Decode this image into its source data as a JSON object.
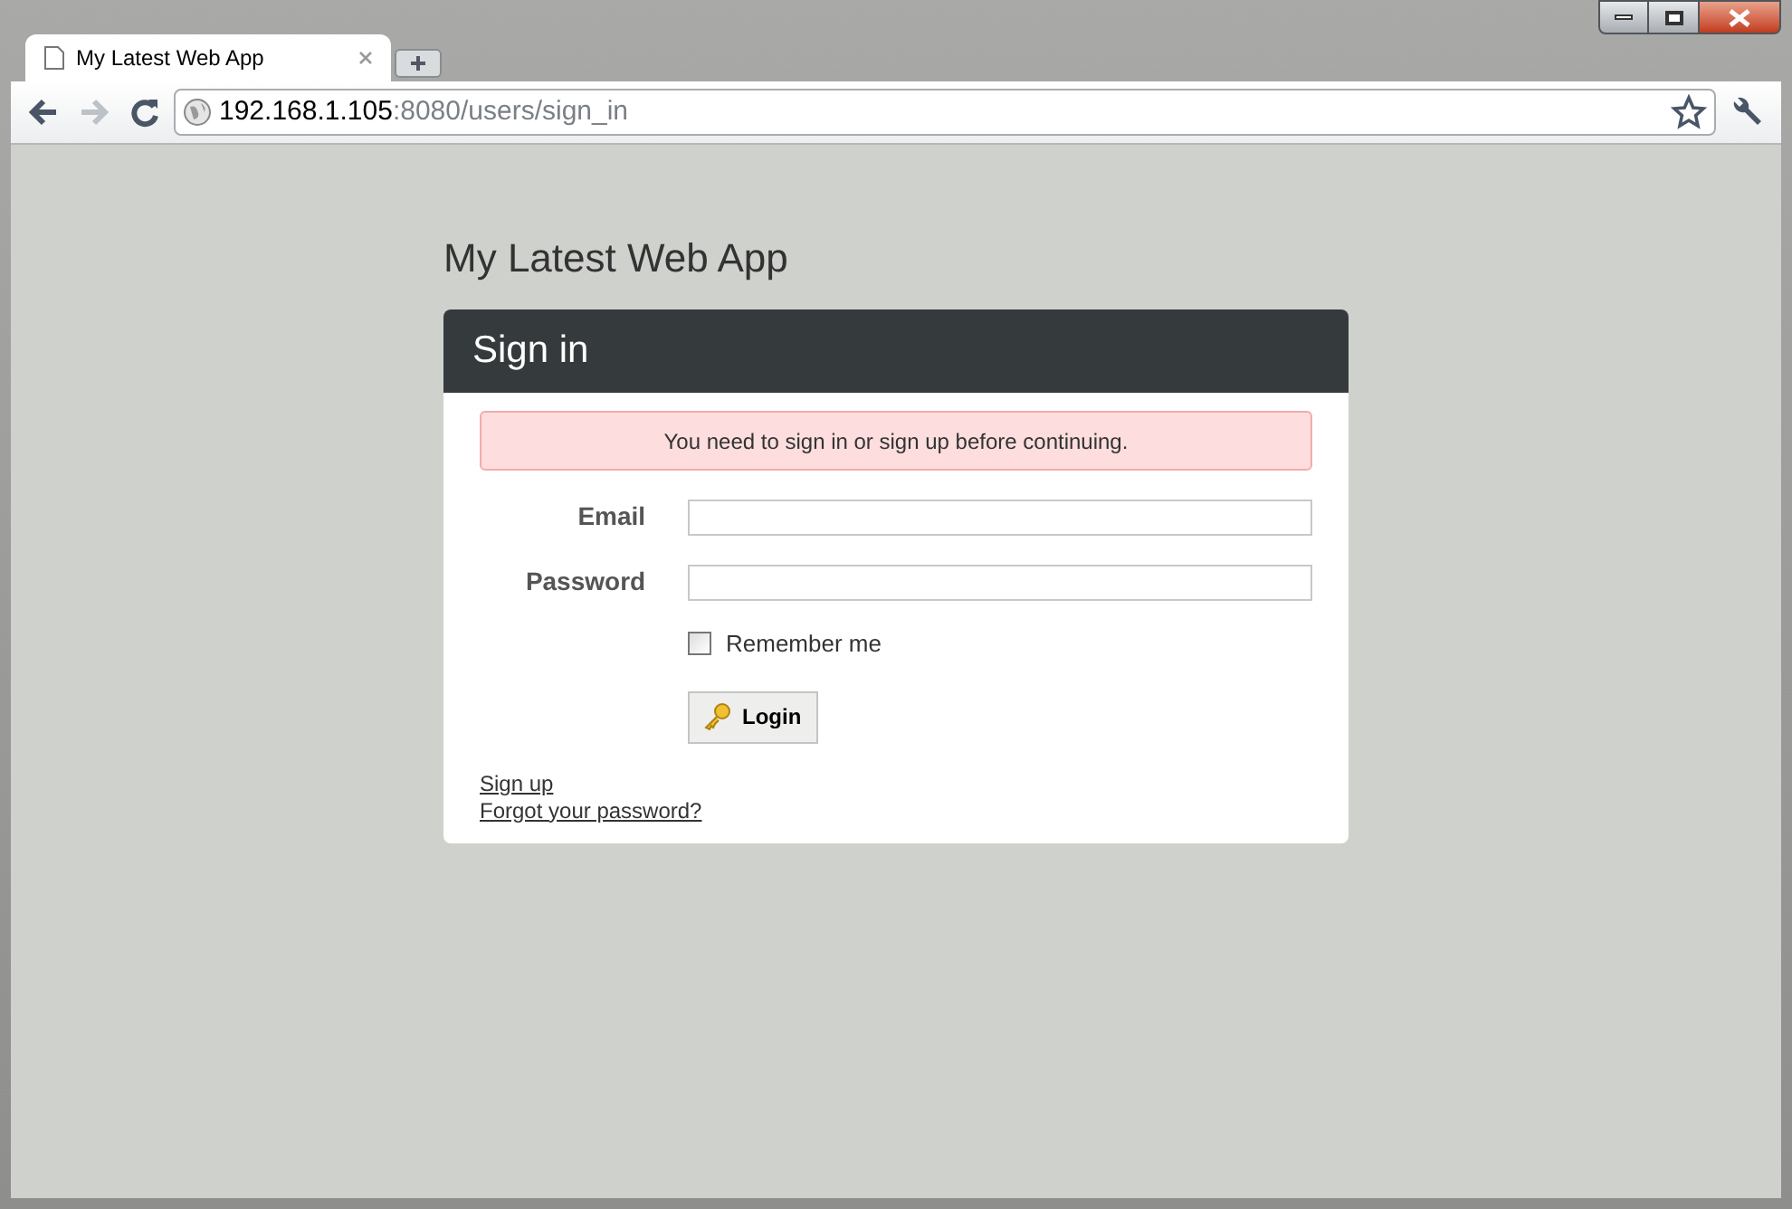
{
  "browser": {
    "tab": {
      "title": "My Latest Web App"
    },
    "address": {
      "host": "192.168.1.105",
      "path": ":8080/users/sign_in"
    }
  },
  "page": {
    "app_title": "My Latest Web App",
    "panel_title": "Sign in",
    "alert": "You need to sign in or sign up before continuing.",
    "fields": [
      {
        "label": "Email"
      },
      {
        "label": "Password"
      }
    ],
    "remember": {
      "label": "Remember me",
      "checked": false
    },
    "login_button": "Login",
    "links": [
      "Sign up",
      "Forgot your password?"
    ]
  }
}
